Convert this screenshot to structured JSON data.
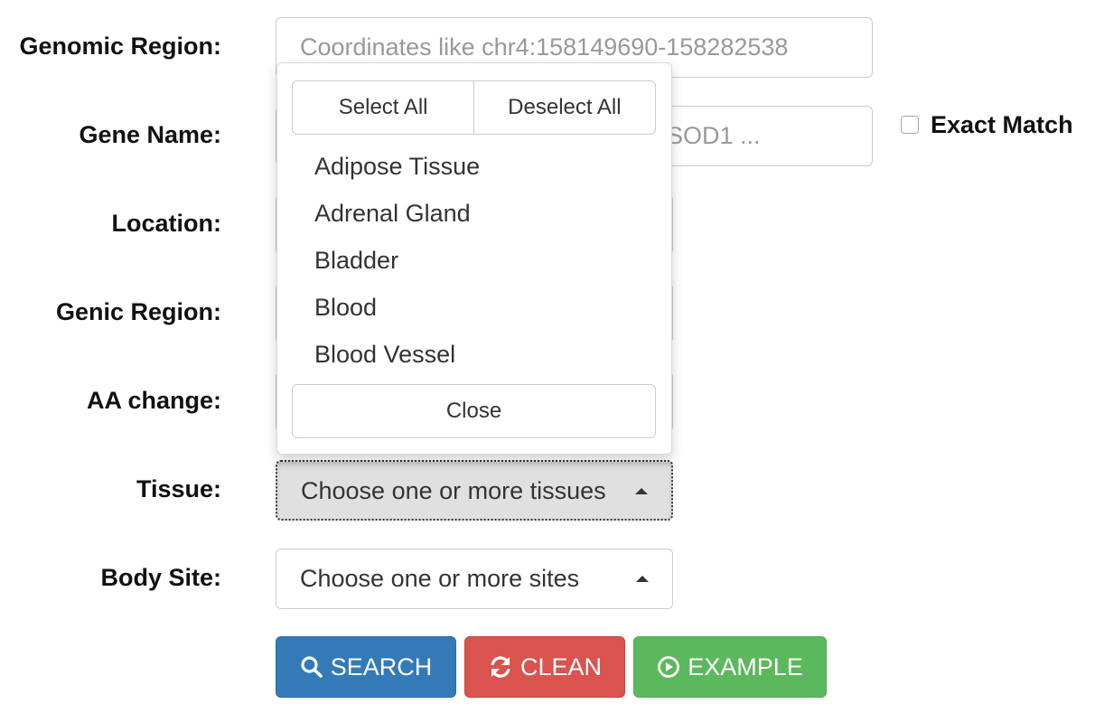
{
  "form": {
    "genomic_region": {
      "label": "Genomic Region:",
      "placeholder": "Coordinates like chr4:158149690-158282538"
    },
    "gene_name": {
      "label": "Gene Name:",
      "placeholder_visible": "SOD1 ...",
      "exact_match_label": "Exact Match",
      "exact_match_checked": false
    },
    "location": {
      "label": "Location:"
    },
    "genic_region": {
      "label": "Genic Region:"
    },
    "aa_change": {
      "label": "AA change:"
    },
    "tissue": {
      "label": "Tissue:",
      "button_text": "Choose one or more tissues",
      "open": true
    },
    "body_site": {
      "label": "Body Site:",
      "button_text": "Choose one or more sites"
    }
  },
  "tissue_dropdown": {
    "select_all_label": "Select All",
    "deselect_all_label": "Deselect All",
    "options": [
      "Adipose Tissue",
      "Adrenal Gland",
      "Bladder",
      "Blood",
      "Blood Vessel"
    ],
    "close_label": "Close"
  },
  "actions": {
    "search_label": "SEARCH",
    "search_icon": "search-icon",
    "clean_label": "CLEAN",
    "clean_icon": "refresh-icon",
    "example_label": "EXAMPLE",
    "example_icon": "play-circle-icon"
  },
  "colors": {
    "search": "#337ab7",
    "clean": "#d9534f",
    "example": "#5cb85c",
    "active_select_bg": "#e0e0e0"
  }
}
